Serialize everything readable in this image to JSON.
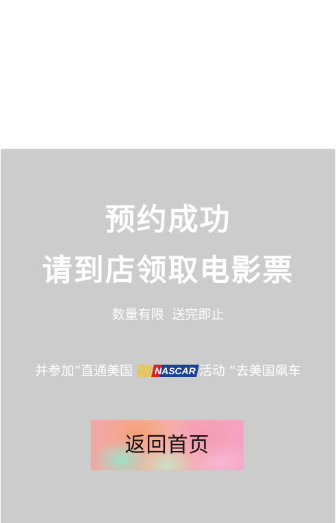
{
  "panel": {
    "title_line1": "预约成功",
    "title_line2": "请到店领取电影票",
    "subtitle": "数量有限  送完即止",
    "event": {
      "prefix": "并参加”直通美国",
      "logo_text": "NASCAR",
      "suffix": "活动 “去美国飙车"
    },
    "home_button_label": "返回首页"
  },
  "colors": {
    "panel_bg": "#cccccc",
    "text": "#ffffff",
    "button_text": "#111111",
    "nascar_blue": "#1f3f94",
    "nascar_red": "#d8202a",
    "nascar_yellow": "#f5c400"
  }
}
